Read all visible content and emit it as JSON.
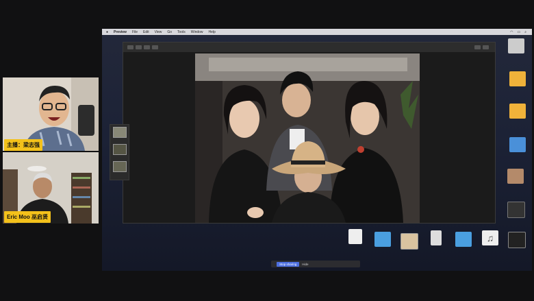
{
  "participants": [
    {
      "label": "主播：梁志强",
      "role": "host"
    },
    {
      "label": "Eric Moo 巫启贤",
      "role": "guest"
    }
  ],
  "menubar": {
    "app": "Preview",
    "items": [
      "File",
      "Edit",
      "View",
      "Go",
      "Tools",
      "Window",
      "Help"
    ]
  },
  "sidebar_thumbs": [
    "",
    "",
    ""
  ],
  "notice": {
    "text": "",
    "stop_label": "Stop sharing",
    "hide_label": "Hide"
  },
  "desktop_files": [
    "",
    "",
    "",
    "",
    "",
    "",
    ""
  ],
  "colors": {
    "label_bg": "#f3c11b",
    "stop_button": "#4d6fe0"
  }
}
